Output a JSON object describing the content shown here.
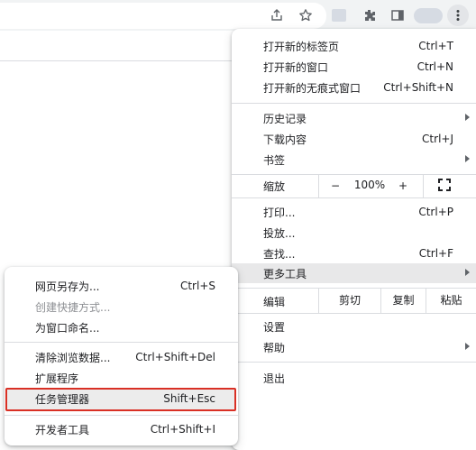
{
  "toolbar": {
    "icons": [
      "share-icon",
      "star-icon",
      "extensions-icon",
      "side-panel-icon",
      "more-vert-icon"
    ]
  },
  "main_menu": {
    "new_tab": {
      "label": "打开新的标签页",
      "shortcut": "Ctrl+T"
    },
    "new_window": {
      "label": "打开新的窗口",
      "shortcut": "Ctrl+N"
    },
    "incognito": {
      "label": "打开新的无痕式窗口",
      "shortcut": "Ctrl+Shift+N"
    },
    "history": {
      "label": "历史记录"
    },
    "downloads": {
      "label": "下载内容",
      "shortcut": "Ctrl+J"
    },
    "bookmarks": {
      "label": "书签"
    },
    "zoom": {
      "label": "缩放",
      "minus": "−",
      "value": "100%",
      "plus": "+"
    },
    "print": {
      "label": "打印...",
      "shortcut": "Ctrl+P"
    },
    "cast": {
      "label": "投放..."
    },
    "find": {
      "label": "查找...",
      "shortcut": "Ctrl+F"
    },
    "more_tools": {
      "label": "更多工具"
    },
    "edit": {
      "label": "编辑",
      "cut": "剪切",
      "copy": "复制",
      "paste": "粘贴"
    },
    "settings": {
      "label": "设置"
    },
    "help": {
      "label": "帮助"
    },
    "exit": {
      "label": "退出"
    }
  },
  "sub_menu": {
    "save_page": {
      "label": "网页另存为...",
      "shortcut": "Ctrl+S"
    },
    "create_shortcut": {
      "label": "创建快捷方式..."
    },
    "name_window": {
      "label": "为窗口命名..."
    },
    "clear_data": {
      "label": "清除浏览数据...",
      "shortcut": "Ctrl+Shift+Del"
    },
    "extensions": {
      "label": "扩展程序"
    },
    "task_manager": {
      "label": "任务管理器",
      "shortcut": "Shift+Esc"
    },
    "dev_tools": {
      "label": "开发者工具",
      "shortcut": "Ctrl+Shift+I"
    }
  },
  "colors": {
    "highlight_border": "#d93025",
    "hover_bg": "#e8e8e9",
    "toolbar_bg": "#f1f3f4"
  }
}
